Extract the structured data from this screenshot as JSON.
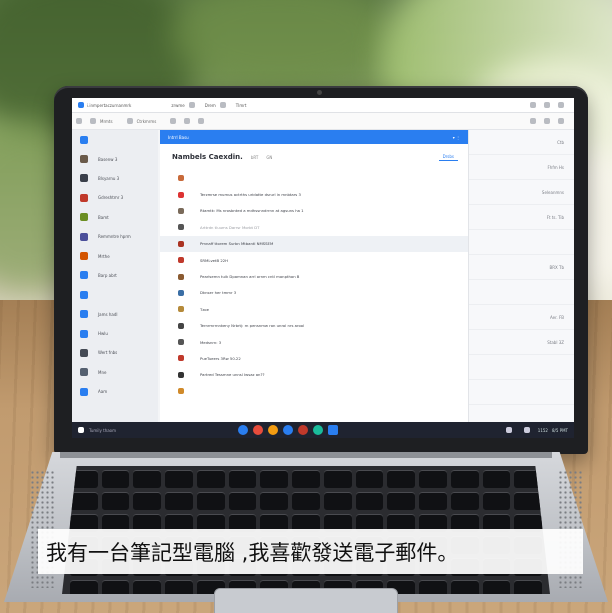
{
  "caption": {
    "text": "我有一台筆記型電腦 ,我喜歡發送電子郵件。"
  },
  "email_app": {
    "title_bar": {
      "app_name": "i.inmpertaczurnanmrk",
      "menu": [
        "zrwme",
        "Drem",
        "Tlmrt"
      ]
    },
    "toolbar": {
      "items": [
        "Mrmts",
        "Ctrkmrms"
      ]
    },
    "sidebar": {
      "items": [
        {
          "label": "",
          "icon": "account-circle-icon",
          "color": "#2a7ef0"
        },
        {
          "label": "Basenw 3",
          "icon": "avatar-icon",
          "color": "#6a5a4a"
        },
        {
          "label": "Blsyarnu 3",
          "icon": "inbox-icon",
          "color": "#3a3f4a"
        },
        {
          "label": "Gdreshtmr 3",
          "icon": "folder-icon",
          "color": "#c0392b"
        },
        {
          "label": "Bamt",
          "icon": "pencil-icon",
          "color": "#6b8e23"
        },
        {
          "label": "Remmntre hprm",
          "icon": "document-icon",
          "color": "#4b4f9a"
        },
        {
          "label": "Mrthe",
          "icon": "mail-icon",
          "color": "#d35400"
        },
        {
          "label": "Barp abrt",
          "icon": "calendar-icon",
          "color": "#2a7ef0"
        },
        {
          "label": "",
          "icon": "contacts-icon",
          "color": "#2a7ef0"
        },
        {
          "label": "Jams hadl",
          "icon": "tasks-icon",
          "color": "#2a7ef0"
        },
        {
          "label": "Hwlu",
          "icon": "notes-icon",
          "color": "#2a7ef0"
        },
        {
          "label": "Wert fnbs",
          "icon": "user-icon",
          "color": "#444a55"
        },
        {
          "label": "Mne",
          "icon": "image-icon",
          "color": "#556070"
        },
        {
          "label": "Aam",
          "icon": "settings-icon",
          "color": "#2a7ef0"
        }
      ]
    },
    "main": {
      "header_label": "Intrrl Basu",
      "subject": "Nambels Caexdin.",
      "subject_meta": [
        "bRT",
        "GN"
      ],
      "tab_label": "Drsbs",
      "messages": [
        {
          "text": "",
          "icon_color": "#c86a3a",
          "highlight": false,
          "faint": false
        },
        {
          "text": "Terzmrse mumus actrths uridatte dsrurl in mnbtars 3",
          "icon_color": "#d33",
          "highlight": false,
          "faint": false
        },
        {
          "text": "Rtamtk: Ms nrosbnted a mdhssnndrrnn at agsuns ha 1",
          "icon_color": "#7a6a5a",
          "highlight": false,
          "faint": false
        },
        {
          "text": "Arttrdn tluums Darrsr Morbt DT",
          "icon_color": "#555",
          "highlight": false,
          "faint": true
        },
        {
          "text": "Pmnaff ttorem Surbn Mtbantl NMSSEM",
          "icon_color": "#aa3322",
          "highlight": true,
          "faint": false
        },
        {
          "text": "SRMLvetB 22H",
          "icon_color": "#c0392b",
          "highlight": false,
          "faint": false
        },
        {
          "text": "Pearlsemn tuik Dpamnan arrl ornm cntl monpthon B",
          "icon_color": "#8a5a30",
          "highlight": false,
          "faint": false
        },
        {
          "text": "Dknser her tmmr 3",
          "icon_color": "#3a6ea5",
          "highlight": false,
          "faint": false
        },
        {
          "text": "Tzoe",
          "icon_color": "#b58a3a",
          "highlight": false,
          "faint": false
        },
        {
          "text": "Ternrmrrnnkeny Nrbrtj: rn pensnmw ron unrol nrs arool",
          "icon_color": "#444",
          "highlight": false,
          "faint": false
        },
        {
          "text": "Medsnrn: 3",
          "icon_color": "#555",
          "highlight": false,
          "faint": false
        },
        {
          "text": "PueTueers 3Rw 50.22",
          "icon_color": "#c0392b",
          "highlight": false,
          "faint": false
        },
        {
          "text": "Partred Tessmne unnsl Iwsaz an??",
          "icon_color": "#333",
          "highlight": false,
          "faint": false
        },
        {
          "text": "",
          "icon_color": "#d08a2a",
          "highlight": false,
          "faint": false
        }
      ]
    },
    "right_pane": {
      "items": [
        "Ctb",
        "Fhfm Hs",
        "Seleanmns",
        "Ft ts. Tib",
        "",
        "BRX Tb",
        "",
        "Aer. FB",
        "Stabl 3Z",
        "",
        "",
        ""
      ]
    },
    "taskbar": {
      "search_text": "Tumily thaom",
      "app_colors": [
        "#2a7ef0",
        "#e74c3c",
        "#f39c12",
        "#2a7ef0",
        "#c0392b",
        "#1abc9c",
        "#2a7ef0"
      ],
      "clock": "1152",
      "date": "8/5 PMT"
    }
  }
}
